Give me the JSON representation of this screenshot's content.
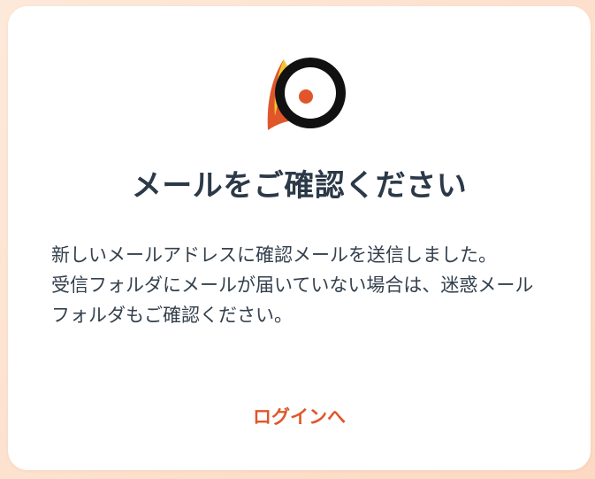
{
  "card": {
    "logo_icon": "bird-eye-logo-icon",
    "title": "メールをご確認ください",
    "message_lines": [
      "新しいメールアドレスに確認メールを送信しました。",
      "受信フォルダにメールが届いていない場合は、迷惑メールフォルダもご確認ください。"
    ],
    "login_link_label": "ログインへ"
  },
  "colors": {
    "accent": "#e0562a",
    "title_text": "#2b3948",
    "body_text": "#34404d",
    "background_gradient_start": "#fde9da",
    "background_gradient_end": "#fcd9c2"
  }
}
